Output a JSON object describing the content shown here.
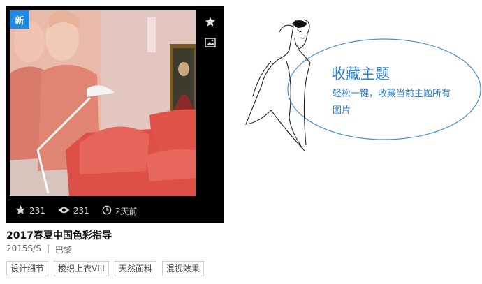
{
  "card": {
    "badge": "新",
    "stats": {
      "favorites": "231",
      "views": "231",
      "time": "2天前"
    }
  },
  "item": {
    "title": "2017春夏中国色彩指导",
    "season": "2015S/S",
    "separator": "|",
    "location": "巴黎",
    "tags": [
      "设计细节",
      "梭织上衣VIII",
      "天然面料",
      "混视效果"
    ]
  },
  "promo": {
    "title": "收藏主题",
    "desc": "轻松一键，收藏当前主题所有图片"
  },
  "icons": [
    "star-icon",
    "image-icon",
    "eye-icon",
    "clock-icon"
  ],
  "colors": {
    "accent": "#1e88e5",
    "promo_text": "#2b7fd4",
    "card_bg": "#000000"
  }
}
